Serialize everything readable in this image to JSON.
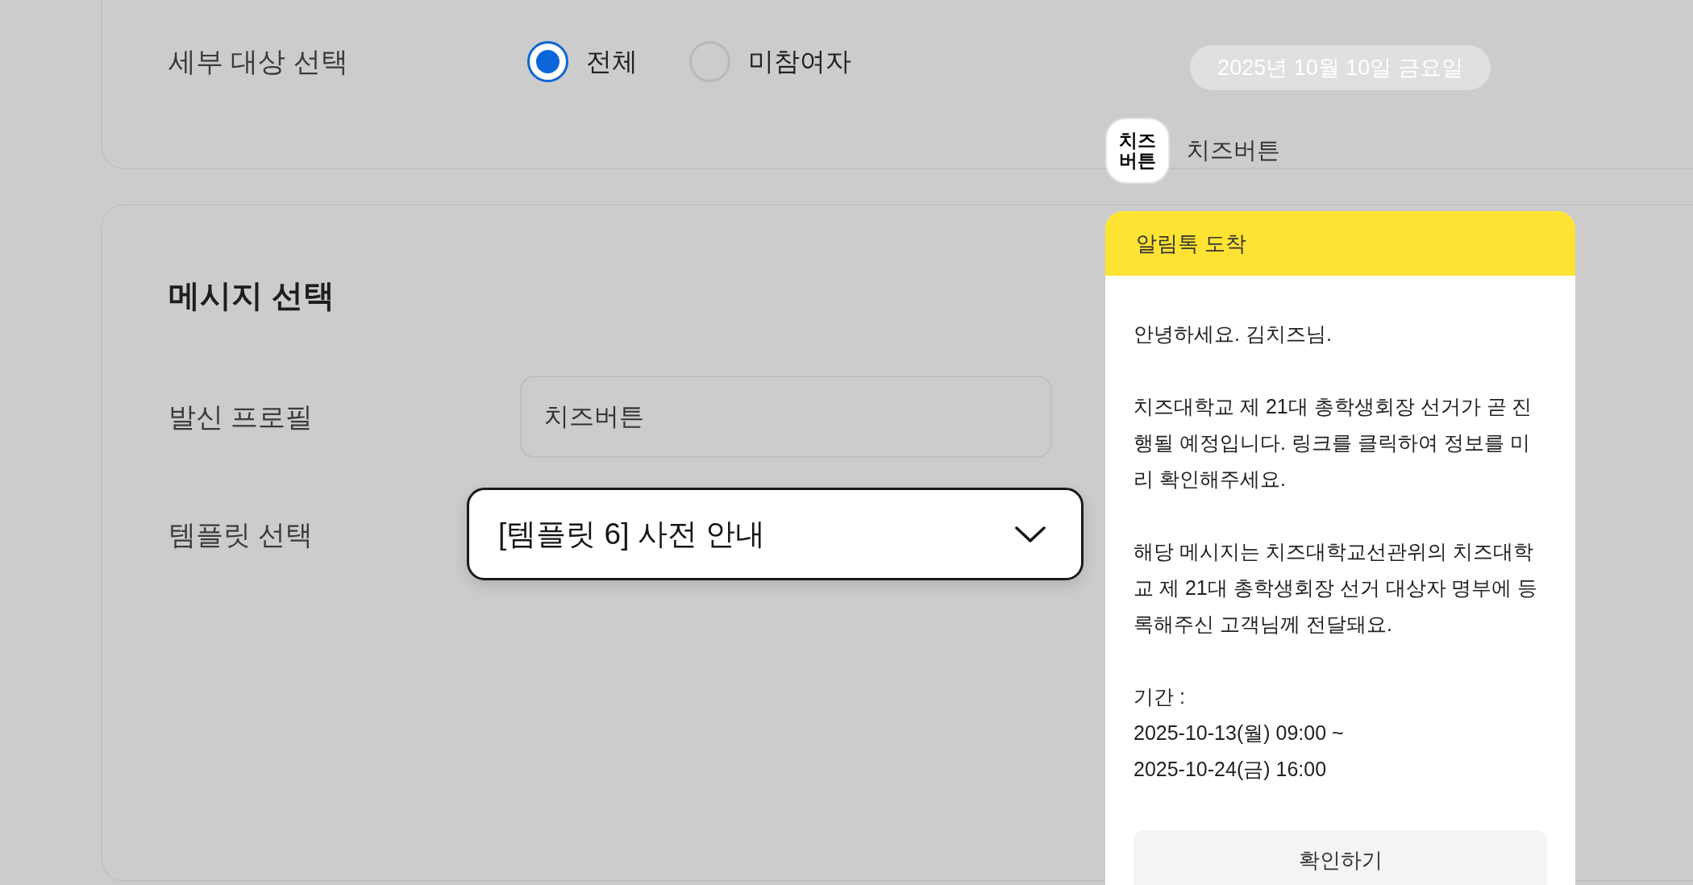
{
  "target_section": {
    "label": "세부 대상 선택",
    "options": [
      {
        "label": "전체",
        "selected": true
      },
      {
        "label": "미참여자",
        "selected": false
      }
    ]
  },
  "message_section": {
    "title": "메시지 선택",
    "sender_profile": {
      "label": "발신 프로필",
      "value": "치즈버튼"
    },
    "template": {
      "label": "템플릿 선택",
      "value": "[템플릿 6] 사전 안내"
    }
  },
  "preview": {
    "date": "2025년 10월 10일 금요일",
    "profile": {
      "logo_text": "치즈\n버튼",
      "name": "치즈버튼"
    },
    "message": {
      "header": "알림톡 도착",
      "paragraphs": [
        "안녕하세요. 김치즈님.",
        "치즈대학교 제 21대 총학생회장 선거가 곧 진행될 예정입니다. 링크를 클릭하여 정보를 미리 확인해주세요.",
        "해당 메시지는 치즈대학교선관위의 치즈대학교 제 21대 총학생회장 선거 대상자 명부에 등록해주신 고객님께 전달돼요.",
        "기간 :\n2025-10-13(월) 09:00 ~\n2025-10-24(금) 16:00"
      ],
      "button": "확인하기"
    }
  }
}
